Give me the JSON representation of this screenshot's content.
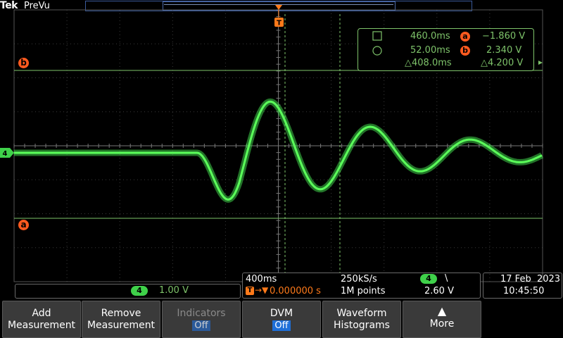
{
  "header": {
    "brand": "Tek",
    "mode": "PreVu"
  },
  "trigger_marker": "T",
  "cursor_labels": {
    "a": "a",
    "b": "b"
  },
  "channel_marker": "4",
  "cursor_readout": {
    "row1": {
      "time": "460.0ms",
      "badge": "a",
      "volt": "−1.860 V"
    },
    "row2": {
      "time": "52.00ms",
      "badge": "b",
      "volt": "2.340 V"
    },
    "row3": {
      "dtime": "△408.0ms",
      "dvolt": "△4.200 V"
    }
  },
  "channel": {
    "number": "4",
    "scale": "1.00 V"
  },
  "horizontal": {
    "scale": "400ms",
    "sample_rate": "250kS/s",
    "trigger_channel": "4",
    "trigger_slope": "\\",
    "trigger_position_tag": "T",
    "trigger_arrow": "→▼",
    "trigger_position": "0.000000 s",
    "record_length": "1M points",
    "trigger_level": "2.60 V"
  },
  "datetime": {
    "date": "17 Feb  2023",
    "time": "10:45:50"
  },
  "buttons": [
    {
      "l1": "Add",
      "l2": "Measurement"
    },
    {
      "l1": "Remove",
      "l2": "Measurement"
    },
    {
      "l1": "Indicators",
      "l2": "Off"
    },
    {
      "l1": "DVM",
      "l2": "Off"
    },
    {
      "l1": "Waveform",
      "l2": "Histograms"
    },
    {
      "l1": "▲",
      "l2": "More"
    }
  ],
  "colors": {
    "waveform": "#3fd14a",
    "cursor": "#7ec36a",
    "cursor_badge": "#ff5a1f",
    "trigger": "#ff7a1a",
    "button_bg": "#3a3a3a",
    "off_tag": "#1e6fd8"
  }
}
